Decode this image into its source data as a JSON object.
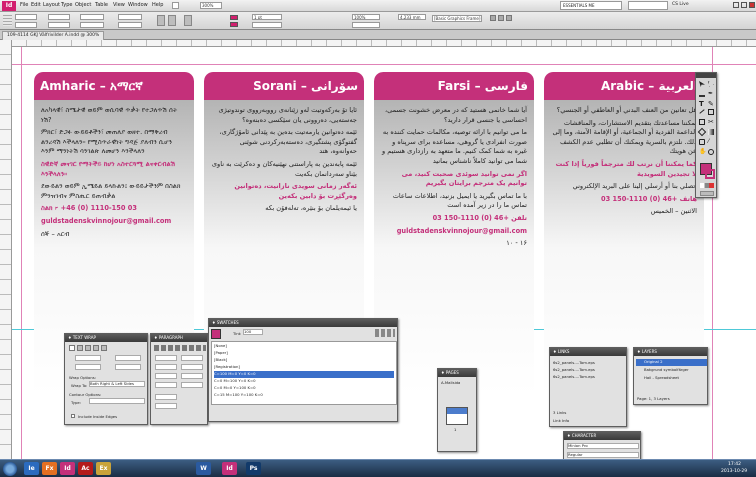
{
  "app": {
    "logo": "Id",
    "menus": [
      "File",
      "Edit",
      "Layout",
      "Type",
      "Object",
      "Table",
      "View",
      "Window",
      "Help"
    ],
    "zoom": "300%",
    "workspace": "ESSENTIALS ME",
    "cslive": "CS Live",
    "search_placeholder": ""
  },
  "control_bar": {
    "stroke_weight": "1 pt",
    "width_value": "4,233 mm",
    "frame_style": "[Basic Graphics Frame]+",
    "percent": "100%"
  },
  "document_tab": "109-4114 GKJ Välfrivilder A.indd @ 300%",
  "columns": [
    {
      "title": "Amharic – አማርኛ",
      "rtl": false,
      "paragraphs": [
        {
          "text": "ለአካላዊ፣ ስሜታዊ ወይም ወሲባዊ ጥቃት የተጋለጥሽ ሰት ነሽ?",
          "pink": false
        },
        {
          "text": "ምክር፣ ድጋፉ ውይይቶችን፣ መጠለያ ወዘተ. በማቅረብ ልንረዳሽ እችላለን። የሚስጥራዊነት ግዳጅ ያለብን ሲሆን እንም ማንነትሽ ሳንገልጽ ለመሆን እንችላለን",
          "pink": false
        },
        {
          "text": "ስዊድኛ መናገር የማትችይ ከሆነ አስተርጓሚ ልናቀርብልሽ እንችላለን።",
          "pink": true
        },
        {
          "text": "ደውይልን ወይም ኢሜይል ይላኩልን፤ ውይይታችንም በስልክ ምንዝገብና ምስጢር ይጠብቃል",
          "pink": false
        },
        {
          "text": "ስልክ ፦ +46 (0) 1110-150 03",
          "pink": true
        },
        {
          "text": "guldstadenskvinnojour@gmail.com",
          "pink": true
        },
        {
          "text": "ሰኞ – አርብ",
          "pink": false
        }
      ]
    },
    {
      "title": "Sorani – سۆرانی",
      "rtl": true,
      "paragraphs": [
        {
          "text": "ئایا تۆ بەرکەوتیت لەو زێنانەی رووبەرووی توندوتیژی جەستەیی، دەروونی یان سێکسی دەبنەوە؟",
          "pink": false
        },
        {
          "text": "ئێمە دەتوانین یارمەتیت بدەین بە پێدانی ئامۆژگاری، گفتوگۆی پشتگیری، دەستەبەرکردنی شوێنی حەوانەوە، هتد",
          "pink": false
        },
        {
          "text": "ئێمە پابەندین بە پاراستنی نهێنیەکان و دەکرێت بە ناوی بێناو سەردانمان بکەیت",
          "pink": false
        },
        {
          "text": "ئەگەر زمانی سویدی نازانیت، دەتوانین وەرگێڕت بۆ دابین بکەین",
          "pink": true
        },
        {
          "text": "یا ئیمەیلمان بۆ بنێرە، تەلەفۆن بکە",
          "pink": false
        }
      ]
    },
    {
      "title": "Farsi – فارسی",
      "rtl": true,
      "paragraphs": [
        {
          "text": "آیا شما خانمی هستید که در معرض خشونت جسمی، احساسی یا جنسی قرار دارید؟",
          "pink": false
        },
        {
          "text": "ما می توانیم با ارائه توصیه، مکالمات حمایت کننده به صورت انفرادی یا گروهی، مساعده برای سرپناه و غیره به شما کمک کنیم. ما متعهد به رازداری هستیم و شما می توانید کاملاً ناشناس بمانید",
          "pink": false
        },
        {
          "text": "اگر نمی توانید سوئدی صحبت کنید، می توانیم یک مترجم برایتان بگیریم",
          "pink": true
        },
        {
          "text": "با ما تماس بگیرید یا ایمیل بزنید، اطلاعات ساعات تماس ما را در زیر آمده است",
          "pink": false
        },
        {
          "text": "تلفن +46 (0) 1110-150 03",
          "pink": true
        },
        {
          "text": "guldstadenskvinnojour@gmail.com",
          "pink": true
        },
        {
          "text": "۱۶ - ۱۰",
          "pink": false
        }
      ]
    },
    {
      "title": "Arabic – العربية",
      "rtl": true,
      "paragraphs": [
        {
          "text": "هل تعانين من العنف البدني أو العاطفي أو الجنسي؟",
          "pink": false
        },
        {
          "text": "يمكننا مساعدتك بتقديم الاستشارات، والمناقشات الداعمة الفردية أو الجماعية، أو الإقامة الآمنة، وما إلى ذلك. نلتزم بالسرية ويمكنك أن تطلبي عدم الكشف عن هويتك",
          "pink": false
        },
        {
          "text": "كما يمكننا أن نرتب لك مترجماً فورياً إذا كنت لا تجيدين السويدية",
          "pink": true
        },
        {
          "text": "اتصلي بنا أو أرسلي إلينا على البريد الإلكتروني",
          "pink": false
        },
        {
          "text": "هاتف +46 (0) 1110-150 03",
          "pink": true
        },
        {
          "text": "الاثنين – الخميس",
          "pink": false
        }
      ]
    }
  ],
  "panels": {
    "text_wrap": {
      "title": "♦ TEXT WRAP",
      "wrap_options": "Wrap Options:",
      "wrap_to": "Wrap To:",
      "wrap_value": "Both Right & Left Sides",
      "contour": "Contour Options:",
      "type": "Type:",
      "include": "Include Inside Edges"
    },
    "paragraph": {
      "title": "♦ PARAGRAPH",
      "justification": "Justification:",
      "just_value": "Standard"
    },
    "swatches": {
      "title": "♦ SWATCHES",
      "tint_label": "Tint:",
      "tint": "100",
      "items": [
        "[None]",
        "[Paper]",
        "[Black]",
        "[Registration]",
        "C=100 M=0 Y=0 K=0",
        "C=0 M=100 Y=0 K=0",
        "C=0 M=0 Y=100 K=0",
        "C=15 M=100 Y=100 K=0"
      ]
    },
    "pages": {
      "title": "♦ PAGES",
      "master": "A-Mallsida",
      "page_num": "1"
    },
    "links": {
      "title": "♦ LINKS",
      "items": [
        "6s2_panels-...Tom.eps",
        "6s2_panels-...Tom.eps",
        "6s2_panels-...Tom.eps"
      ],
      "footer": "3 Links",
      "look_info": "Link Info"
    },
    "layers": {
      "title": "♦ LAYERS",
      "items": [
        "Original 2",
        "Bakgrund symbolfärger",
        "Hail - Spreadsheet"
      ],
      "footer": "Page: 1, 3 Layers"
    },
    "character": {
      "title": "♦ CHARACTER",
      "font": "Minion Pro",
      "style": "Regular"
    }
  },
  "taskbar": {
    "apps": [
      "Ie",
      "Fx",
      "Id",
      "Ac",
      "Ex",
      "W",
      "Id",
      "Ps"
    ],
    "clock": "17:42",
    "date": "2013-10-29"
  }
}
